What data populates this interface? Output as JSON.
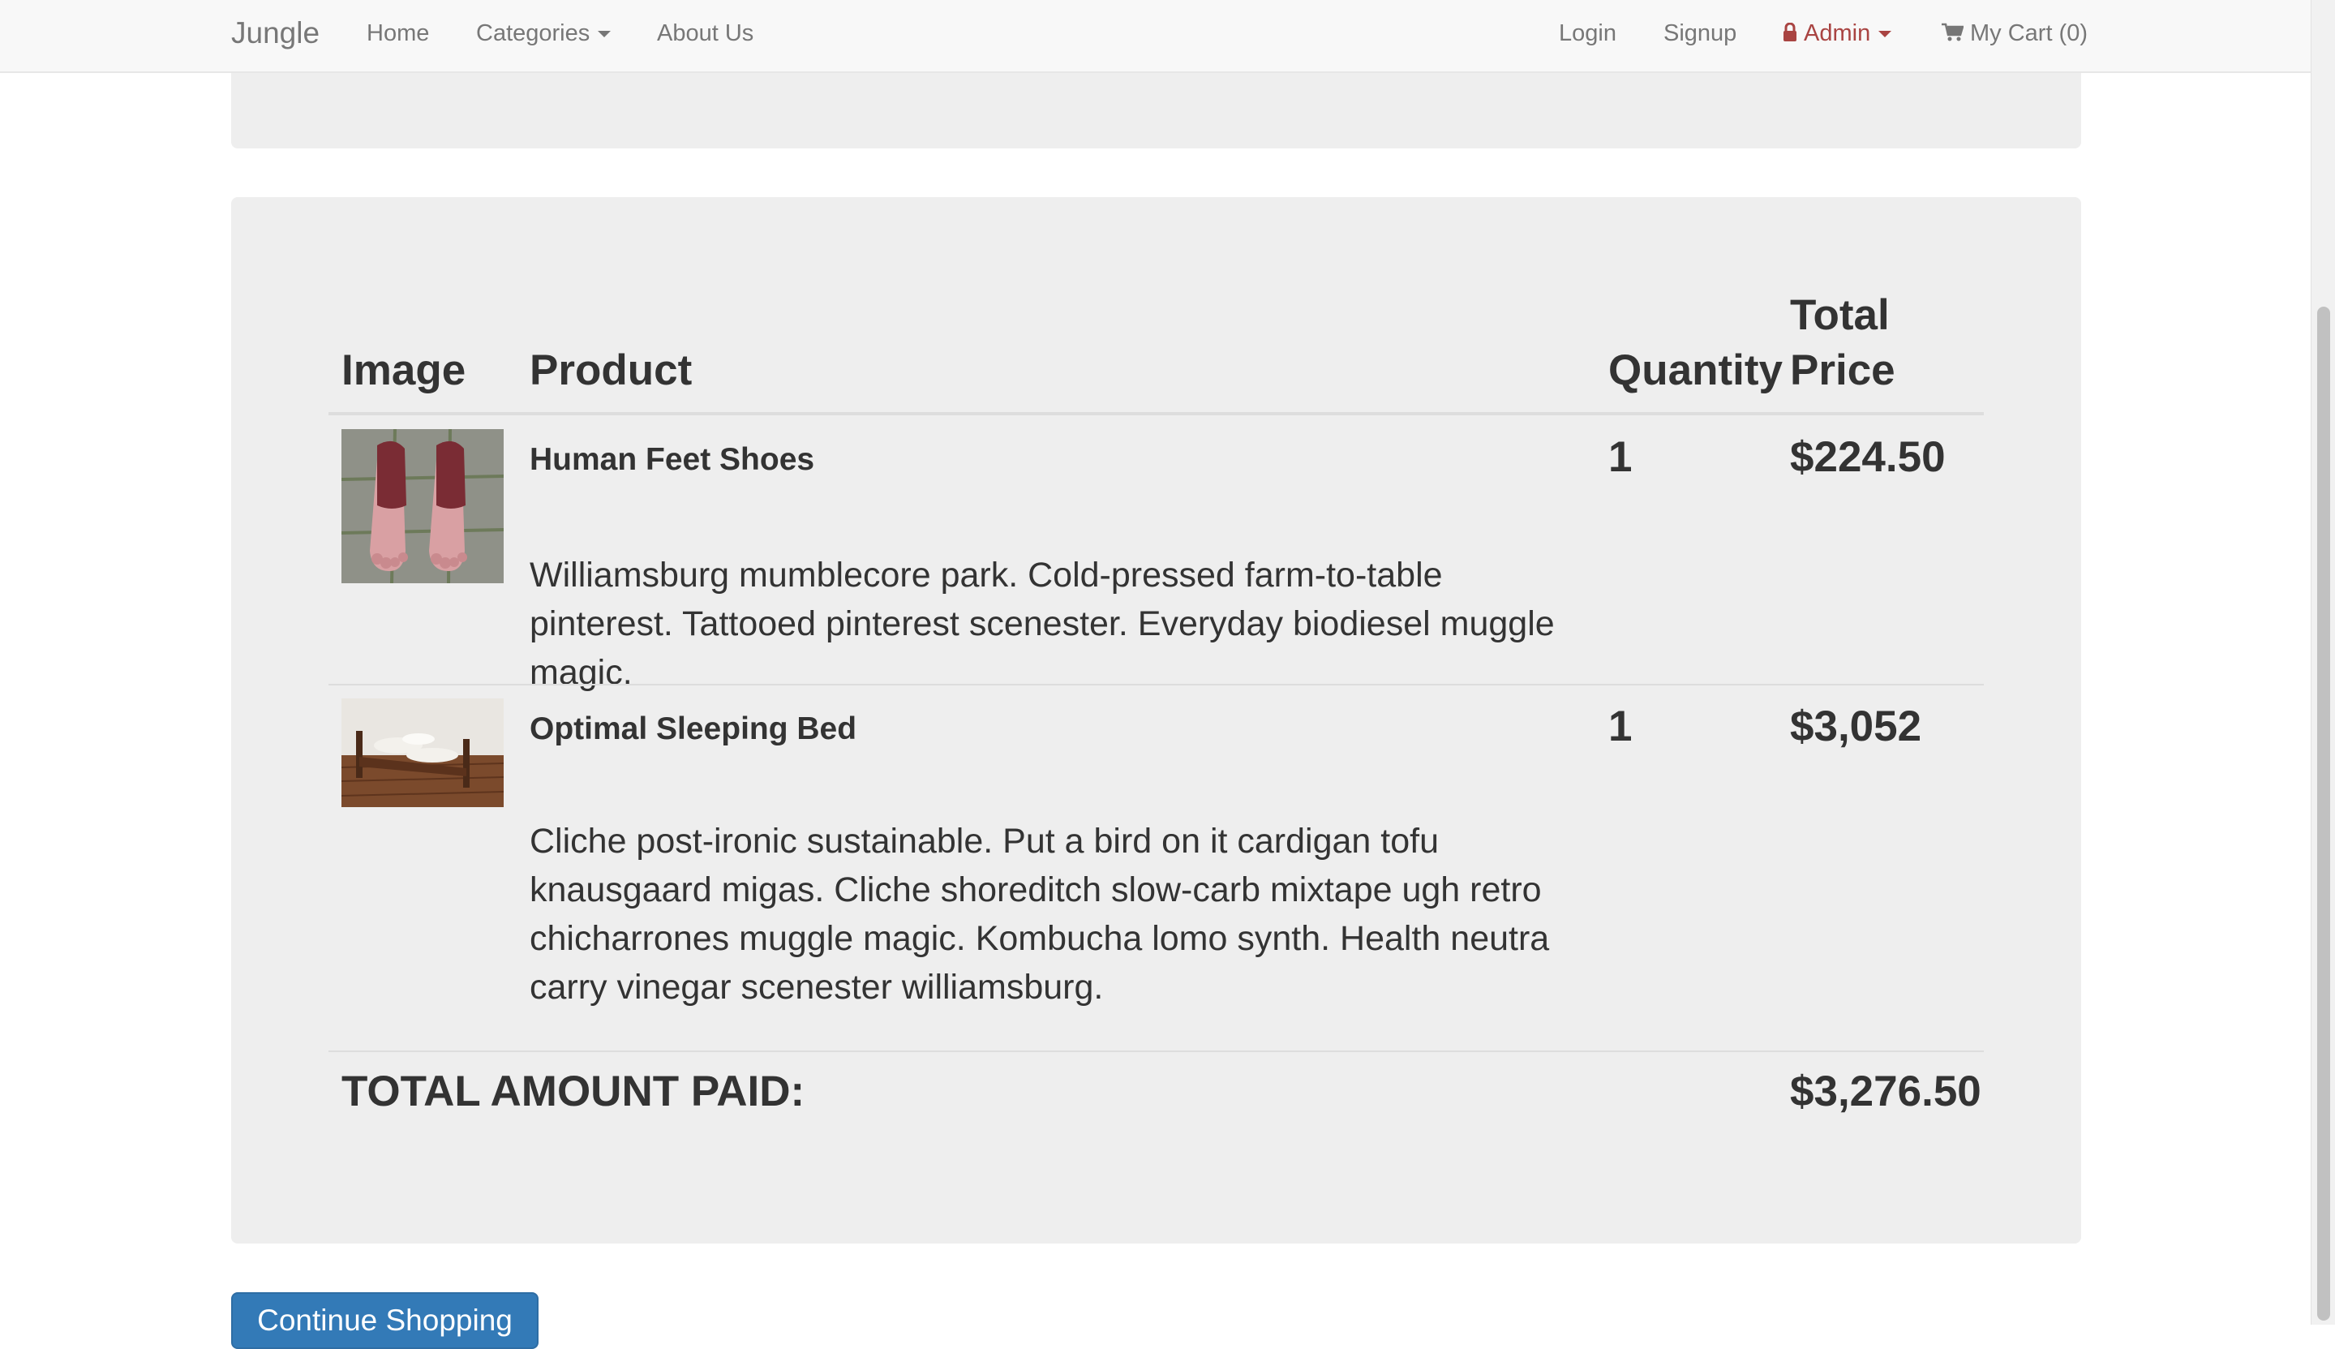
{
  "navbar": {
    "brand": "Jungle",
    "home": "Home",
    "categories": "Categories",
    "about": "About Us",
    "login": "Login",
    "signup": "Signup",
    "admin": "Admin",
    "cart": "My Cart (0)"
  },
  "colors": {
    "admin_red": "#a94442",
    "primary_blue": "#337ab7",
    "well_bg": "#eeeeee",
    "navbar_bg": "#f8f8f8"
  },
  "table": {
    "headers": {
      "image": "Image",
      "product": "Product",
      "quantity": "Quantity",
      "total_price": "Total Price"
    },
    "rows": [
      {
        "image_icon": "shoes-photo",
        "name": "Human Feet Shoes",
        "description": "Williamsburg mumblecore park. Cold-pressed farm-to-table pinterest. Tattooed pinterest scenester. Everyday biodiesel muggle magic.",
        "quantity": "1",
        "price": "$224.50"
      },
      {
        "image_icon": "bed-photo",
        "name": "Optimal Sleeping Bed",
        "description": "Cliche post-ironic sustainable. Put a bird on it cardigan tofu knausgaard migas. Cliche shoreditch slow-carb mixtape ugh retro chicharrones muggle magic. Kombucha lomo synth. Health neutra carry vinegar scenester williamsburg.",
        "quantity": "1",
        "price": "$3,052"
      }
    ],
    "total_label": "TOTAL AMOUNT PAID:",
    "total_value": "$3,276.50"
  },
  "continue_button": "Continue Shopping"
}
